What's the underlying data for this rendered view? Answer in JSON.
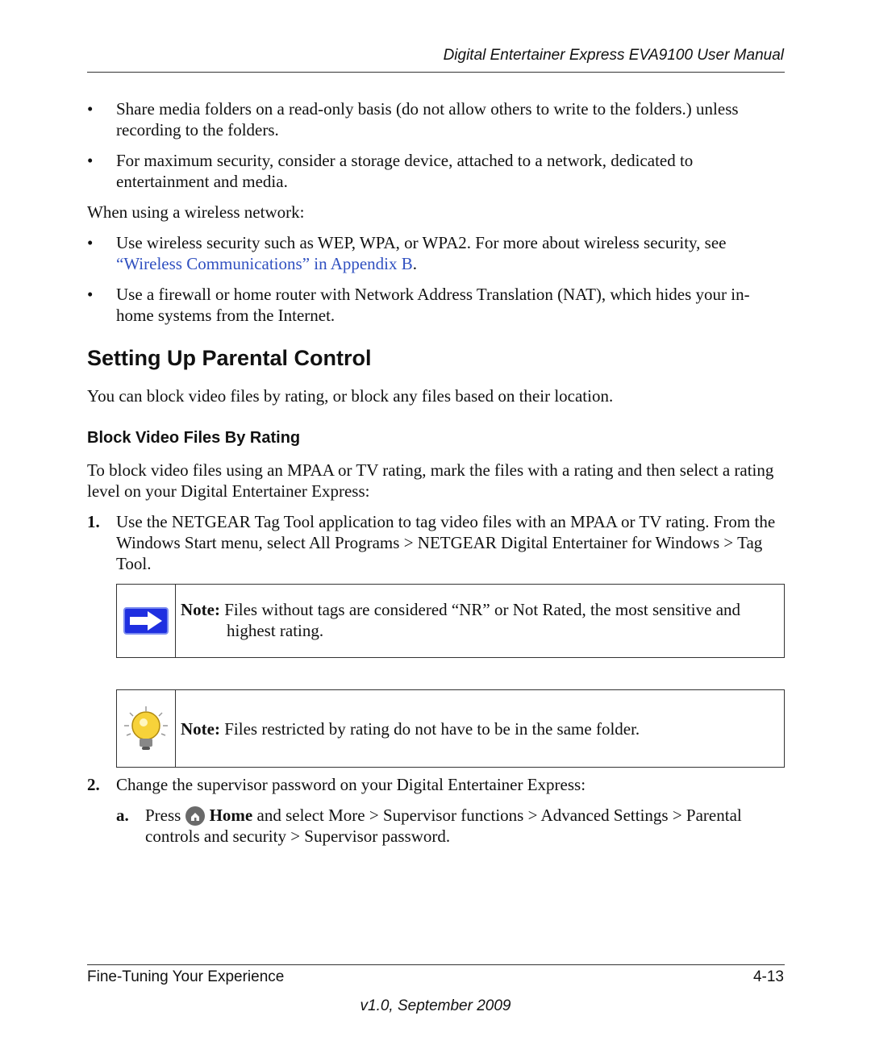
{
  "header": {
    "title": "Digital Entertainer Express EVA9100 User Manual"
  },
  "bullets_top": [
    "Share media folders on a read-only basis (do not allow others to write to the folders.) unless recording to the folders.",
    "For maximum security, consider a storage device, attached to a network, dedicated to entertainment and media."
  ],
  "wireless_intro": "When using a wireless network:",
  "bullet_wireless": {
    "text": "Use wireless security such as WEP, WPA, or WPA2. For more about wireless security, see ",
    "link": "“Wireless Communications” in Appendix B",
    "after": "."
  },
  "bullet_firewall": "Use a firewall or home router with Network Address Translation (NAT), which hides your in-home systems from the Internet.",
  "section": {
    "title": "Setting Up Parental Control",
    "intro": "You can block video files by rating, or block any files based on their location."
  },
  "subsection": {
    "title": "Block Video Files By Rating",
    "intro": "To block video files using an MPAA or TV rating, mark the files with a rating and then select a rating level on your Digital Entertainer Express:"
  },
  "steps": [
    {
      "num": "1.",
      "text": "Use the NETGEAR Tag Tool application to tag video files with an MPAA or TV rating. From the Windows Start menu, select All Programs > NETGEAR Digital Entertainer for Windows > Tag Tool."
    },
    {
      "num": "2.",
      "text": "Change the supervisor password on your Digital Entertainer Express:"
    }
  ],
  "notes": [
    {
      "icon": "arrow-right-icon",
      "label": "Note:",
      "text": " Files without tags are considered “NR” or Not Rated, the most sensitive and highest rating."
    },
    {
      "icon": "lightbulb-icon",
      "label": "Note:",
      "text": " Files restricted by rating do not have to be in the same folder."
    }
  ],
  "substep": {
    "letter": "a.",
    "press": "Press ",
    "home": "Home",
    "rest": " and select More > Supervisor functions > Advanced Settings > Parental controls and security > Supervisor password."
  },
  "footer": {
    "chapter": "Fine-Tuning Your Experience",
    "page": "4-13",
    "version": "v1.0, September 2009"
  }
}
